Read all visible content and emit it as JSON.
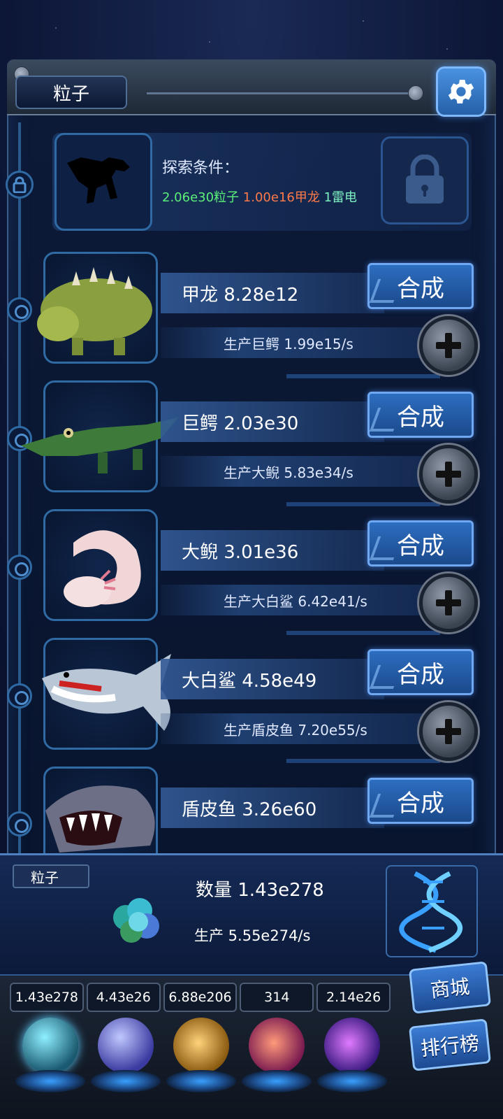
{
  "header": {
    "resource_label": "粒子"
  },
  "locked": {
    "condition_title": "探索条件：",
    "req1": "2.06e30粒子",
    "req2": "1.00e16甲龙",
    "req3": "1雷电"
  },
  "creatures": [
    {
      "name": "甲龙",
      "count": "8.28e12",
      "production": "生产巨鳄 1.99e15/s",
      "merge_label": "合成"
    },
    {
      "name": "巨鳄",
      "count": "2.03e30",
      "production": "生产大鲵 5.83e34/s",
      "merge_label": "合成"
    },
    {
      "name": "大鲵",
      "count": "3.01e36",
      "production": "生产大白鲨 6.42e41/s",
      "merge_label": "合成"
    },
    {
      "name": "大白鲨",
      "count": "4.58e49",
      "production": "生产盾皮鱼 7.20e55/s",
      "merge_label": "合成"
    },
    {
      "name": "盾皮鱼",
      "count": "3.26e60",
      "production": "",
      "merge_label": "合成"
    }
  ],
  "row_labels": {
    "r0": "甲龙 8.28e12",
    "r1": "巨鳄 2.03e30",
    "r2": "大鲵 3.01e36",
    "r3": "大白鲨 4.58e49",
    "r4": "盾皮鱼 3.26e60"
  },
  "resource_panel": {
    "tag": "粒子",
    "quantity": "数量 1.43e278",
    "production": "生产 5.55e274/s"
  },
  "dock": {
    "counts": [
      "1.43e278",
      "4.43e26",
      "6.88e206",
      "314",
      "2.14e26"
    ],
    "shop_label": "商城",
    "rank_label": "排行榜"
  },
  "colors": {
    "accent": "#2d6dc0",
    "green": "#5cf07a",
    "orange": "#ff7a4a"
  }
}
